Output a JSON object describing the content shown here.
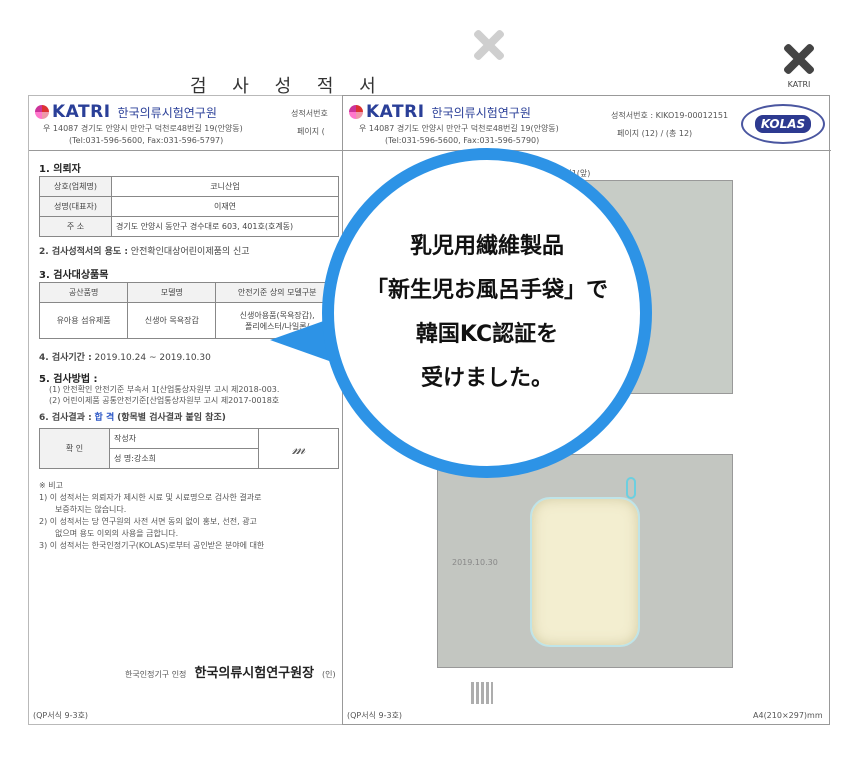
{
  "doc_title": "검 사 성 적 서",
  "katri": {
    "brand": "KATRI",
    "org_name": "한국의류시험연구원",
    "address": "우 14087 경기도 안양시 만안구 덕천로48번길 19(안양동)",
    "tel_left": "(Tel:031-596-5600, Fax:031-596-5797)",
    "tel_right": "(Tel:031-596-5600, Fax:031-596-5790)"
  },
  "left_doc": {
    "cert_no_label": "성적서번호",
    "page_label": "페이지 (",
    "s1_title": "1. 의뢰자",
    "client_rows": [
      {
        "label": "상호(업체명)",
        "value": "코니산업"
      },
      {
        "label": "성명(대표자)",
        "value": "이재연"
      },
      {
        "label": "주  소",
        "value": "경기도 안양시 동안구 경수대로 603, 401호(호계동)"
      }
    ],
    "s2_title": "2. 검사성적서의 용도 :",
    "s2_value": "안전확인대상어린이제품의 신고",
    "s3_title": "3. 검사대상품목",
    "product_headers": [
      "공산품명",
      "모델명",
      "안전기준 상의 모델구분"
    ],
    "product_row": [
      "유아용 섬유제품",
      "신생아 목욕장갑",
      "신생아용품(목욕장갑),",
      "폴리에스터/나일론/"
    ],
    "s4_title": "4. 검사기간 :",
    "s4_value": "2019.10.24 ~ 2019.10.30",
    "s5_title": "5. 검사방법 :",
    "s5_lines": [
      "(1) 안전확인 안전기준 부속서 1[산업통상자원부 고시 제2018-003.",
      "(2) 어린이제품 공통안전기준[산업통상자원부 고시 제2017-0018호"
    ],
    "s6_title": "6. 검사결과 :",
    "s6_result": "합 격",
    "s6_note": "(항목별 검사결과 붙임 참조)",
    "confirm_label": "확 인",
    "writer_label": "작성자",
    "writer_name": "성 명:강소희",
    "remark_title": "※ 비고",
    "remarks": [
      "1) 이 성적서는 의뢰자가 제시한 시료 및 시료명으로 검사한 결과로",
      "보증하지는 않습니다.",
      "2) 이 성적서는 당 연구원의 사전 서면 동의 없이 홍보, 선전, 광고",
      "없으며 용도 이외의 사용을 금합니다.",
      "3) 이 성적서는 한국인정기구(KOLAS)로부터 공인받은 분야에 대한"
    ],
    "footer_auth": "한국인정기구 인정",
    "footer_org": "한국의류시험연구원장",
    "footer_seal": "(인)",
    "form_no": "(QP서식 9-3호)"
  },
  "right_doc": {
    "cert_no": "성적서번호 : KIKO19-00012151",
    "page_info": "페이지 (12) / (총 12)",
    "photo_caption": "사진1(앞)",
    "photo_date": "2019.10.30",
    "form_no": "(QP서식 9-3호)",
    "paper_size": "A4(210×297)mm",
    "kolas": "KOLAS",
    "logo_caption": "KATRI"
  },
  "bubble": {
    "line1": "乳児用繊維製品",
    "line2": "「新生児お風呂手袋」で",
    "line3": "韓国KC認証を",
    "line4": "受けました。"
  },
  "colors": {
    "accent_blue": "#2d93e6",
    "katri_blue": "#2a3f98"
  }
}
